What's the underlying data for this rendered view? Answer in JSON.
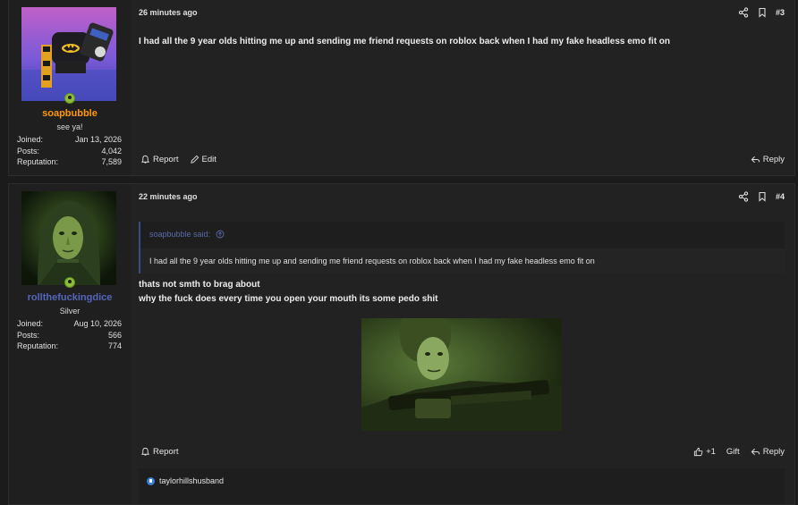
{
  "posts": [
    {
      "user": {
        "name": "soapbubble",
        "name_color": "#ff9900",
        "title": "see ya!",
        "stats": [
          {
            "label": "Joined:",
            "value": "Jan 13, 2026"
          },
          {
            "label": "Posts:",
            "value": "4,042"
          },
          {
            "label": "Reputation:",
            "value": "7,589"
          }
        ]
      },
      "timestamp": "26 minutes ago",
      "post_number": "#3",
      "body": "I had all the 9 year olds hitting me up and sending me friend requests on roblox back when I had my fake headless emo fit on",
      "actions_left": [
        "Report",
        "Edit"
      ],
      "reply_label": "Reply"
    },
    {
      "user": {
        "name": "rollthefuckingdice",
        "name_color": "#5566bb",
        "title": "Silver",
        "stats": [
          {
            "label": "Joined:",
            "value": "Aug 10, 2026"
          },
          {
            "label": "Posts:",
            "value": "566"
          },
          {
            "label": "Reputation:",
            "value": "774"
          }
        ]
      },
      "timestamp": "22 minutes ago",
      "post_number": "#4",
      "quote": {
        "author_line": "soapbubble said:",
        "text": "I had all the 9 year olds hitting me up and sending me friend requests on roblox back when I had my fake headless emo fit on"
      },
      "body_lines": [
        "thats not smth to brag about",
        "why the fuck does every time you open your mouth its some pedo shit"
      ],
      "actions_left": [
        "Report"
      ],
      "like_count": "+1",
      "gift_label": "Gift",
      "reply_label": "Reply",
      "reaction_user": "taylorhillshusband"
    }
  ],
  "icons": {
    "online": "online-status-icon",
    "share": "share-icon",
    "bookmark": "bookmark-icon",
    "report": "bell-icon",
    "edit": "pencil-icon",
    "reply": "reply-arrow-icon",
    "like": "thumbs-up-icon",
    "quote_up": "arrow-up-circle-icon"
  }
}
